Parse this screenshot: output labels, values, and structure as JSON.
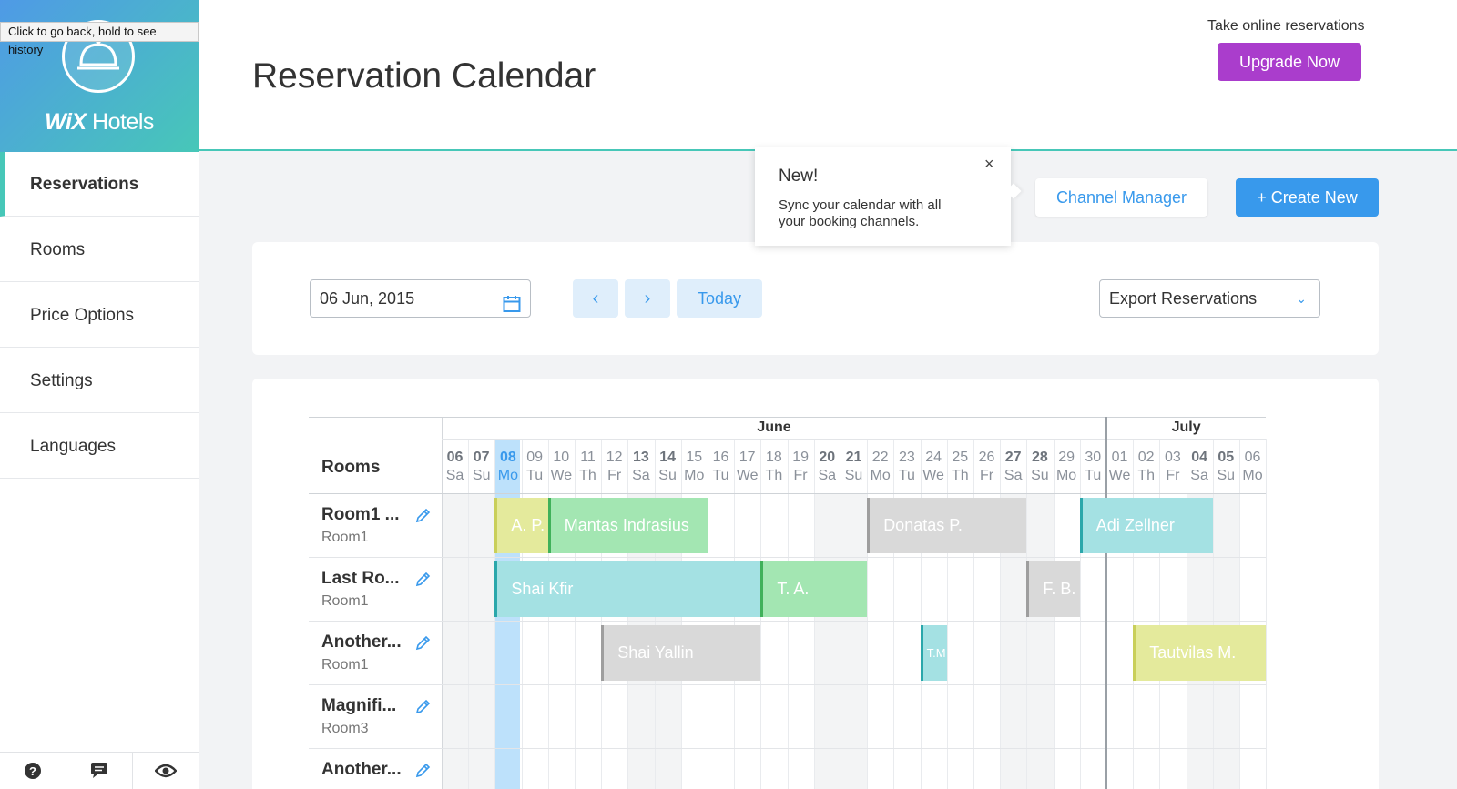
{
  "browser": {
    "tooltip": "Click to go back, hold to see history"
  },
  "brand": {
    "logo_bold": "WiX",
    "logo_rest": "Hotels",
    "icon": "hotel-bell-icon"
  },
  "sidebar": {
    "items": [
      {
        "label": "Reservations",
        "active": true
      },
      {
        "label": "Rooms"
      },
      {
        "label": "Price Options"
      },
      {
        "label": "Settings"
      },
      {
        "label": "Languages"
      }
    ],
    "footer_icons": [
      "help-icon",
      "chat-icon",
      "eye-icon"
    ]
  },
  "header": {
    "title": "Reservation Calendar",
    "online_text": "Take online reservations",
    "upgrade_label": "Upgrade Now"
  },
  "popover": {
    "title": "New!",
    "text": "Sync your calendar with all your booking channels.",
    "close": "×"
  },
  "actions": {
    "channel_manager": "Channel Manager",
    "create_new": "+ Create New"
  },
  "toolbar": {
    "date_value": "06 Jun, 2015",
    "prev": "‹",
    "next": "›",
    "today": "Today",
    "export_label": "Export Reservations",
    "export_chevron": "⌄"
  },
  "calendar": {
    "rooms_header": "Rooms",
    "months": [
      {
        "label": "June",
        "start": 0,
        "span": 25
      },
      {
        "label": "July",
        "start": 25,
        "span": 6
      }
    ],
    "days": [
      {
        "n": "06",
        "d": "Sa",
        "w": true
      },
      {
        "n": "07",
        "d": "Su",
        "w": true
      },
      {
        "n": "08",
        "d": "Mo",
        "today": true
      },
      {
        "n": "09",
        "d": "Tu"
      },
      {
        "n": "10",
        "d": "We"
      },
      {
        "n": "11",
        "d": "Th"
      },
      {
        "n": "12",
        "d": "Fr"
      },
      {
        "n": "13",
        "d": "Sa",
        "w": true
      },
      {
        "n": "14",
        "d": "Su",
        "w": true
      },
      {
        "n": "15",
        "d": "Mo"
      },
      {
        "n": "16",
        "d": "Tu"
      },
      {
        "n": "17",
        "d": "We"
      },
      {
        "n": "18",
        "d": "Th"
      },
      {
        "n": "19",
        "d": "Fr"
      },
      {
        "n": "20",
        "d": "Sa",
        "w": true
      },
      {
        "n": "21",
        "d": "Su",
        "w": true
      },
      {
        "n": "22",
        "d": "Mo"
      },
      {
        "n": "23",
        "d": "Tu"
      },
      {
        "n": "24",
        "d": "We"
      },
      {
        "n": "25",
        "d": "Th"
      },
      {
        "n": "26",
        "d": "Fr"
      },
      {
        "n": "27",
        "d": "Sa",
        "w": true
      },
      {
        "n": "28",
        "d": "Su",
        "w": true
      },
      {
        "n": "29",
        "d": "Mo"
      },
      {
        "n": "30",
        "d": "Tu"
      },
      {
        "n": "01",
        "d": "We"
      },
      {
        "n": "02",
        "d": "Th"
      },
      {
        "n": "03",
        "d": "Fr"
      },
      {
        "n": "04",
        "d": "Sa",
        "w": true
      },
      {
        "n": "05",
        "d": "Su",
        "w": true
      },
      {
        "n": "06",
        "d": "Mo"
      }
    ],
    "rooms": [
      {
        "name": "Room1 ...",
        "type": "Room1"
      },
      {
        "name": "Last Ro...",
        "type": "Room1"
      },
      {
        "name": "Another...",
        "type": "Room1"
      },
      {
        "name": "Magnifi...",
        "type": "Room3"
      },
      {
        "name": "Another...",
        "type": ""
      }
    ],
    "reservations": [
      {
        "room": 0,
        "start": 2,
        "end": 4,
        "label": "A. P.",
        "color": "#e4ea9c",
        "edge": "#c9cf5a"
      },
      {
        "room": 0,
        "start": 4,
        "end": 10,
        "label": "Mantas Indrasius",
        "color": "#a3e6b2",
        "edge": "#40b15a"
      },
      {
        "room": 0,
        "start": 16,
        "end": 22,
        "label": "Donatas P.",
        "color": "#d9d9d9",
        "edge": "#9e9e9e"
      },
      {
        "room": 0,
        "start": 24,
        "end": 29,
        "label": "Adi Zellner",
        "color": "#a4e1e3",
        "edge": "#2aa7ab"
      },
      {
        "room": 1,
        "start": 2,
        "end": 12,
        "label": "Shai Kfir",
        "color": "#a4e1e3",
        "edge": "#2aa7ab"
      },
      {
        "room": 1,
        "start": 12,
        "end": 16,
        "label": "T. A.",
        "color": "#a3e6b2",
        "edge": "#40b15a"
      },
      {
        "room": 1,
        "start": 22,
        "end": 24,
        "label": "F. B.",
        "color": "#d9d9d9",
        "edge": "#9e9e9e"
      },
      {
        "room": 2,
        "start": 6,
        "end": 12,
        "label": "Shai Yallin",
        "color": "#d9d9d9",
        "edge": "#9e9e9e"
      },
      {
        "room": 2,
        "start": 18,
        "end": 19,
        "label": "T.M",
        "color": "#a4e1e3",
        "edge": "#2aa7ab"
      },
      {
        "room": 2,
        "start": 26,
        "end": 31,
        "label": "Tautvilas M.",
        "color": "#e4ea9c",
        "edge": "#c9cf5a"
      }
    ]
  },
  "colors": {
    "accent": "#3899ec",
    "teal": "#47c7b8",
    "upgrade": "#aa3dcc"
  }
}
